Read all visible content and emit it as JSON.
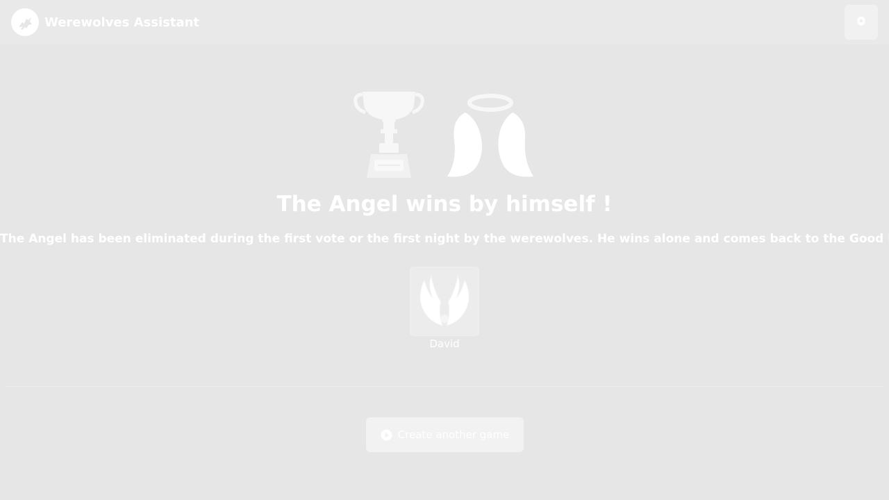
{
  "app": {
    "title": "Werewolves Assistant"
  },
  "header": {
    "logo_icon": "wolf-logo-icon",
    "settings_icon": "gear-icon"
  },
  "victory": {
    "title": "The Angel wins by himself !",
    "description": "The Angel has been eliminated during the first vote or the first night by the werewolves. He wins alone and comes back to the Good Place.",
    "icons": [
      "trophy-icon",
      "angel-wings-icon"
    ]
  },
  "winners": [
    {
      "name": "David",
      "role_icon": "angel-role-icon"
    }
  ],
  "actions": {
    "create_game_label": "Create another game",
    "create_game_icon": "play-circle-icon"
  },
  "colors": {
    "background": "#e6e6e6",
    "navbar": "#e9e9e9",
    "text": "#ffffff",
    "button": "#f2f2f2"
  }
}
